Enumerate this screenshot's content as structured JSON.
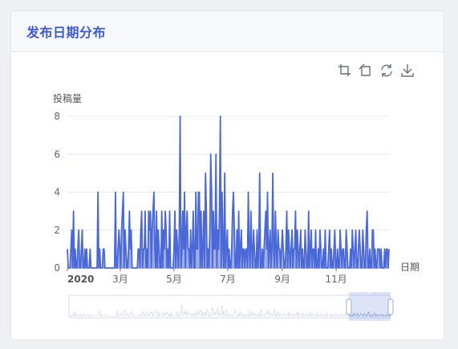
{
  "card": {
    "title": "发布日期分布"
  },
  "toolbox": {
    "items": [
      {
        "name": "zoom-select-icon",
        "label": "区域缩放"
      },
      {
        "name": "zoom-back-icon",
        "label": "区域缩放还原"
      },
      {
        "name": "restore-icon",
        "label": "还原"
      },
      {
        "name": "save-image-icon",
        "label": "保存为图片"
      }
    ]
  },
  "colors": {
    "title": "#3d5bd8",
    "series": "#4a68d8",
    "area": "#8da0e6",
    "grid": "#e6e9f0"
  },
  "chart_data": {
    "type": "area",
    "title": "",
    "xlabel": "日期",
    "ylabel": "投稿量",
    "ylim": [
      0,
      8
    ],
    "yticks": [
      "0",
      "2",
      "4",
      "6",
      "8"
    ],
    "x_start": "2020-01-01",
    "x_end": "2020-12-31",
    "xticks": [
      {
        "date": "2020-01-01",
        "label": "2020",
        "bold": true
      },
      {
        "date": "2020-03-01",
        "label": "3月",
        "bold": false
      },
      {
        "date": "2020-05-01",
        "label": "5月",
        "bold": false
      },
      {
        "date": "2020-07-01",
        "label": "7月",
        "bold": false
      },
      {
        "date": "2020-09-01",
        "label": "9月",
        "bold": false
      },
      {
        "date": "2020-11-01",
        "label": "11月",
        "bold": false
      }
    ],
    "grid": true,
    "series": [
      {
        "values": [
          1,
          0,
          0,
          0,
          1,
          2,
          0,
          3,
          0,
          1,
          0,
          0,
          1,
          2,
          0,
          0,
          1,
          2,
          0,
          0,
          1,
          0,
          1,
          0,
          0,
          0,
          1,
          0,
          0,
          0,
          0,
          0,
          0,
          0,
          0,
          4,
          0,
          1,
          0,
          0,
          0,
          1,
          1,
          0,
          0,
          0,
          0,
          0,
          0,
          0,
          0,
          0,
          0,
          0,
          0,
          4,
          0,
          0,
          1,
          2,
          1,
          0,
          2,
          3,
          4,
          0,
          2,
          1,
          0,
          0,
          1,
          3,
          1,
          2,
          0,
          0,
          0,
          0,
          0,
          0,
          0,
          1,
          1,
          0,
          2,
          3,
          0,
          1,
          1,
          3,
          0,
          1,
          0,
          3,
          2,
          3,
          0,
          2,
          3,
          4,
          1,
          0,
          3,
          0,
          2,
          1,
          0,
          0,
          3,
          0,
          2,
          1,
          3,
          2,
          0,
          1,
          0,
          3,
          0,
          0,
          0,
          0,
          1,
          3,
          0,
          2,
          1,
          0,
          2,
          8,
          0,
          1,
          3,
          1,
          4,
          0,
          2,
          3,
          1,
          1,
          0,
          2,
          0,
          1,
          3,
          0,
          0,
          4,
          1,
          1,
          4,
          4,
          0,
          3,
          0,
          1,
          3,
          0,
          5,
          3,
          0,
          1,
          0,
          2,
          6,
          4,
          0,
          3,
          1,
          1,
          6,
          0,
          2,
          1,
          3,
          8,
          0,
          4,
          1,
          0,
          5,
          0,
          1,
          2,
          0,
          1,
          0,
          0,
          1,
          3,
          4,
          2,
          0,
          0,
          2,
          0,
          3,
          0,
          1,
          2,
          0,
          1,
          1,
          0,
          1,
          1,
          0,
          4,
          1,
          0,
          3,
          1,
          0,
          2,
          1,
          0,
          0,
          2,
          0,
          1,
          5,
          0,
          0,
          1,
          0,
          1,
          2,
          3,
          1,
          4,
          0,
          1,
          2,
          0,
          1,
          5,
          1,
          0,
          3,
          1,
          0,
          2,
          1,
          1,
          0,
          1,
          2,
          1,
          0,
          0,
          1,
          3,
          0,
          2,
          1,
          0,
          1,
          2,
          0,
          1,
          1,
          3,
          0,
          2,
          1,
          0,
          1,
          2,
          0,
          1,
          0,
          0,
          2,
          1,
          0,
          0,
          3,
          0,
          1,
          2,
          0,
          1,
          1,
          0,
          2,
          0,
          0,
          1,
          0,
          2,
          1,
          0,
          0,
          1,
          0,
          2,
          0,
          0,
          0,
          1,
          2,
          0,
          1,
          0,
          0,
          1,
          2,
          0,
          0,
          1,
          0,
          0,
          2,
          1,
          0,
          1,
          1,
          0,
          0,
          2,
          1,
          0,
          0,
          0,
          1,
          0,
          2,
          1,
          0,
          1,
          2,
          0,
          0,
          1,
          2,
          1,
          0,
          0,
          2,
          1,
          0,
          0,
          2,
          3,
          0,
          0,
          1,
          0,
          0,
          2,
          2,
          0,
          1,
          0,
          0,
          1,
          1,
          1,
          0,
          1,
          0,
          0,
          0,
          1,
          0,
          1,
          1,
          0,
          1
        ]
      }
    ]
  },
  "datazoom": {
    "start_percent": 87,
    "end_percent": 100,
    "handle_label": "|||"
  }
}
